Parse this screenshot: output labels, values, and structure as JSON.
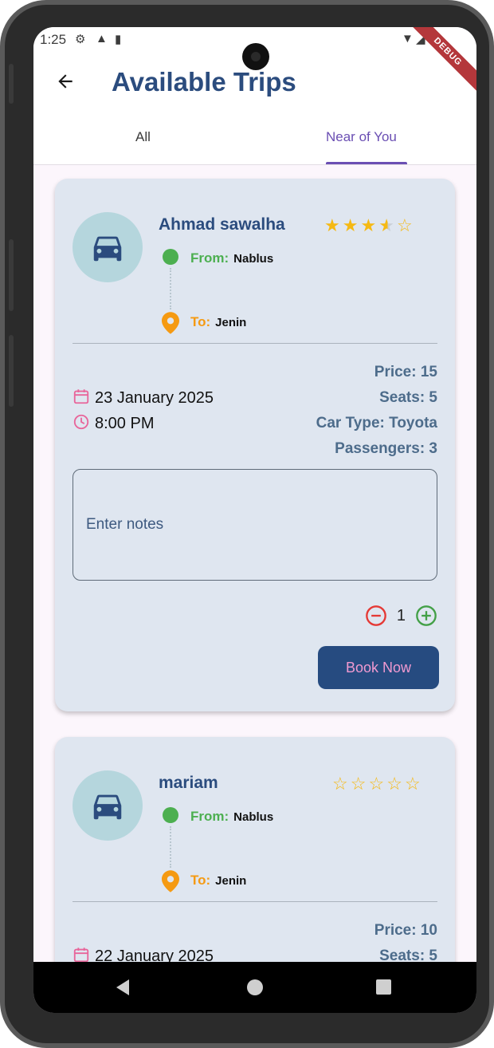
{
  "status_bar": {
    "time": "1:25"
  },
  "debug_banner": "DEBUG",
  "app_bar": {
    "title": "Available Trips"
  },
  "tabs": [
    {
      "label": "All",
      "selected": false
    },
    {
      "label": "Near of You",
      "selected": true
    }
  ],
  "trips": [
    {
      "driver": "Ahmad sawalha",
      "rating": 3.5,
      "rating_max": 5,
      "from_label": "From:",
      "from": "Nablus",
      "to_label": "To:",
      "to": "Jenin",
      "date": "23 January 2025",
      "time": "8:00 PM",
      "price": "Price: 15",
      "seats": "Seats: 5",
      "car_type": "Car Type: Toyota",
      "passengers": "Passengers: 3",
      "notes_placeholder": "Enter notes",
      "quantity": "1",
      "book_label": "Book Now"
    },
    {
      "driver": "mariam",
      "rating": 0,
      "rating_max": 5,
      "from_label": "From:",
      "from": "Nablus",
      "to_label": "To:",
      "to": "Jenin",
      "date": "22 January 2025",
      "price": "Price: 10",
      "seats": "Seats: 5"
    }
  ],
  "colors": {
    "title": "#2b4c7e",
    "tab_active": "#6b4fb3",
    "card_bg": "#dfe6f0",
    "avatar_bg": "#b5d6dd",
    "from_green": "#4caf50",
    "to_orange": "#f59a12",
    "star": "#f5b914",
    "info_text": "#4d6c8b",
    "date_icon": "#e8659a",
    "minus_red": "#e53935",
    "plus_green": "#43a047",
    "button_bg": "#264b80",
    "button_text": "#f19ad0"
  },
  "icons": {
    "back": "arrow-back-icon",
    "avatar": "car-icon",
    "from": "green-dot-icon",
    "to": "location-pin-icon",
    "date": "calendar-icon",
    "time": "clock-icon",
    "minus": "remove-circle-icon",
    "plus": "add-circle-icon"
  }
}
